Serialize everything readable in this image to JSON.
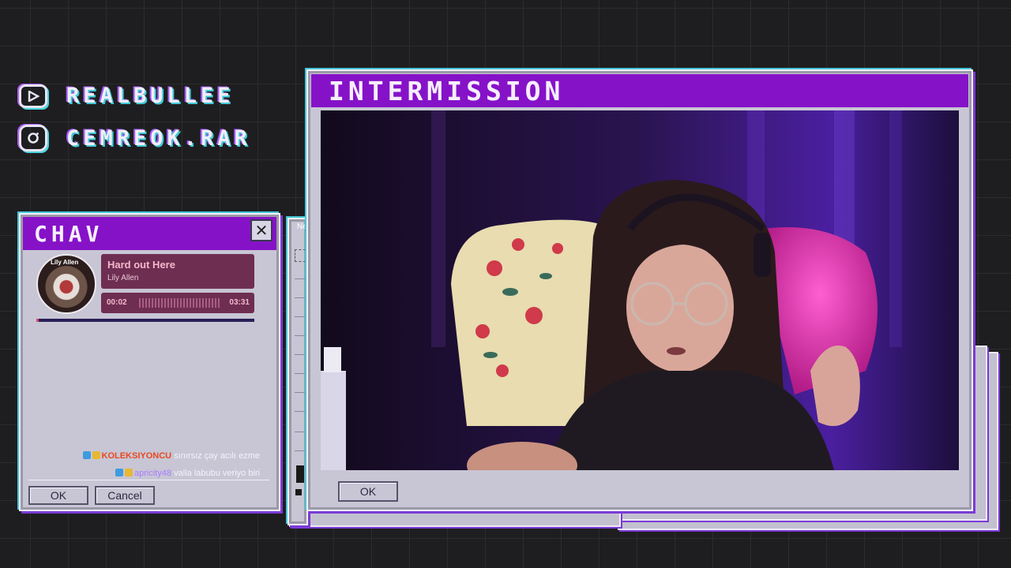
{
  "socials": [
    {
      "icon": "youtube-icon",
      "handle": "REALBULLEE"
    },
    {
      "icon": "instagram-icon",
      "handle": "CEMREOK.RAR"
    }
  ],
  "cam_window": {
    "title": "INTERMISSION",
    "ok_label": "OK"
  },
  "chat_window": {
    "title": "CHAV",
    "now_playing": {
      "album_label": "Lily Allen",
      "title": "Hard out Here",
      "artist": "Lily Allen",
      "elapsed": "00:02",
      "duration": "03:31",
      "progress": 0.01
    },
    "messages": [
      {
        "user": "KOLEKSIYONCU",
        "user_color": "#e8481f",
        "text": "sınırsız çay acılı ezme"
      },
      {
        "user": "apricity48",
        "user_color": "#a77bff",
        "text": "valla labubu veriyo biri"
      }
    ],
    "ok_label": "OK",
    "cancel_label": "Cancel"
  },
  "toolbox": {
    "partial_title": "Ne"
  },
  "colors": {
    "title_bar": "#8612c8",
    "window_face": "#c8c6d4",
    "accent_cyan": "#45c7d8",
    "player_bg": "#6e2e52"
  }
}
